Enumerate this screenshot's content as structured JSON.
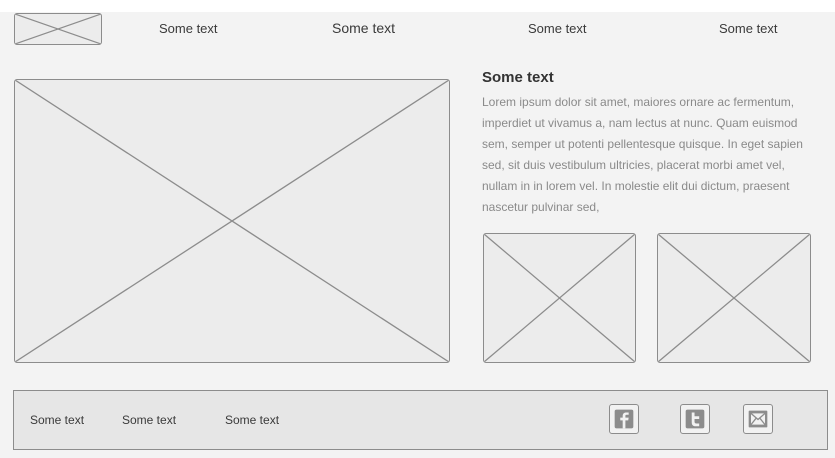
{
  "nav": {
    "items": [
      {
        "label": "Some text"
      },
      {
        "label": "Some text"
      },
      {
        "label": "Some text"
      },
      {
        "label": "Some text"
      }
    ]
  },
  "content": {
    "heading": "Some text",
    "paragraph": "Lorem ipsum dolor sit amet, maiores ornare ac fermentum, imperdiet ut vivamus a, nam lectus at nunc. Quam euismod sem, semper ut potenti pellentesque quisque. In eget sapien sed, sit duis vestibulum ultricies, placerat morbi amet vel, nullam in in lorem vel. In molestie elit dui dictum, praesent nascetur pulvinar sed,"
  },
  "footer": {
    "links": [
      {
        "label": "Some text"
      },
      {
        "label": "Some text"
      },
      {
        "label": "Some text"
      }
    ],
    "social": [
      {
        "icon": "facebook-icon"
      },
      {
        "icon": "twitter-icon"
      },
      {
        "icon": "email-icon"
      }
    ]
  },
  "colors": {
    "background": "#f3f3f3",
    "placeholder_stroke": "#8c8c8c",
    "placeholder_fill": "#ececec",
    "footer_fill": "#e6e6e6"
  }
}
